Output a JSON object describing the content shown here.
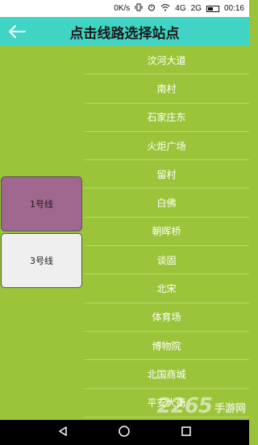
{
  "status_bar": {
    "speed": "0K/s",
    "network_1": "4G",
    "network_2": "2G",
    "time": "00:16",
    "colors": {
      "bg": "#ffffff"
    }
  },
  "header": {
    "title": "点击线路选择站点",
    "back_icon": "arrow-left-icon",
    "colors": {
      "bg": "#3fd4c4"
    }
  },
  "lines": [
    {
      "label": "1号线",
      "selected": true,
      "color": "#a0678f"
    },
    {
      "label": "3号线",
      "selected": false,
      "color": "#efefef"
    }
  ],
  "stations": [
    "汶河大道",
    "南村",
    "石家庄东",
    "火炬广场",
    "留村",
    "白佛",
    "朝晖桥",
    "谈固",
    "北宋",
    "体育场",
    "博物院",
    "北国商城",
    "平安大街"
  ],
  "watermark": {
    "number": "2265",
    "text": "手游网"
  },
  "nav_bar": {
    "back_icon": "triangle-back-icon",
    "home_icon": "circle-home-icon",
    "recents_icon": "square-recents-icon"
  },
  "colors": {
    "background": "#9bc43a"
  }
}
